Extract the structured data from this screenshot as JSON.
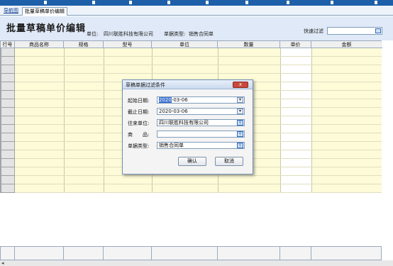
{
  "tabs": {
    "home": "导航图",
    "active": "批量草稿单价编辑"
  },
  "header": {
    "title": "批量草稿单价编辑",
    "unit_label": "单位:",
    "unit_value": "四川联胜科技有限公司",
    "type_label": "单据类型:",
    "type_value": "销售合同单",
    "quick_filter_label": "快速过滤",
    "quick_filter_value": ""
  },
  "grid": {
    "columns": [
      "行号",
      "商品名称",
      "规格",
      "型号",
      "单位",
      "数量",
      "单价",
      "金额"
    ],
    "rows": []
  },
  "dialog": {
    "title": "草稿单据过滤条件",
    "close_label": "x",
    "start_date_label": "起始日期:",
    "start_date_highlight": "2020",
    "start_date_rest": "-03-06",
    "end_date_label": "截止日期:",
    "end_date_value": "2020-03-06",
    "partner_label": "往来单位:",
    "partner_value": "四川联胜科技有限公司",
    "product_label": "商　　品:",
    "product_value": "",
    "doc_type_label": "单据类型:",
    "doc_type_value": "销售合同单",
    "ok_label": "确认",
    "cancel_label": "取消"
  },
  "icons": {
    "dropdown": "chevron-down-icon",
    "search": "magnifier-icon",
    "scroll_left": "arrow-left-icon"
  },
  "colors": {
    "topbar": "#1d5fa8",
    "header_bg": "#dfe9f7",
    "editable_column": "#fdfbd8",
    "selection": "#3a6fd0"
  }
}
